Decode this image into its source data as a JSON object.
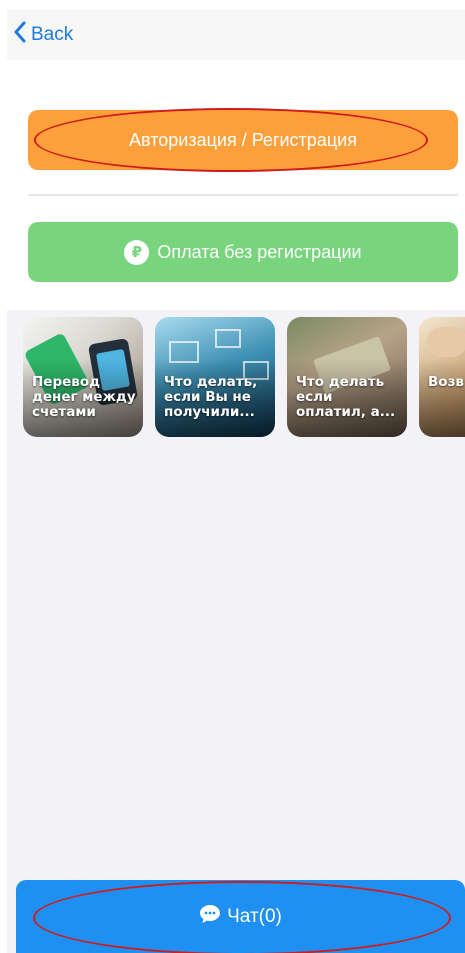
{
  "navbar": {
    "back_label": "Back"
  },
  "buttons": {
    "auth_label": "Авторизация / Регистрация",
    "pay_label": "Оплата без регистрации",
    "pay_icon": "₽"
  },
  "stories": [
    {
      "label": "Перевод денег между счетами"
    },
    {
      "label": "Что делать, если Вы не получили..."
    },
    {
      "label": "Что делать если оплатил, а..."
    },
    {
      "label": "Возв дене"
    }
  ],
  "chat": {
    "label": "Чат(0)"
  },
  "colors": {
    "accent": "#1f8ff1",
    "auth_button": "#fda03c",
    "pay_button": "#79d47e",
    "back_link": "#1f7ae0",
    "annotation": "#d01c1c"
  }
}
